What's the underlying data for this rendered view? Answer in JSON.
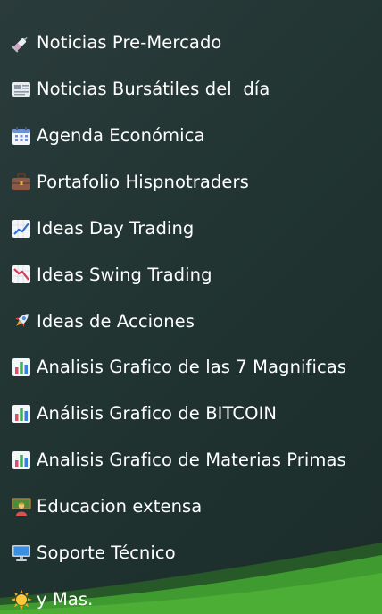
{
  "menu": {
    "items": [
      {
        "label": "Noticias Pre-Mercado",
        "icon": "syringe-icon"
      },
      {
        "label": "Noticias Bursátiles del  día",
        "icon": "newspaper-icon"
      },
      {
        "label": "Agenda Económica",
        "icon": "calendar-icon"
      },
      {
        "label": "Portafolio Hispnotraders",
        "icon": "briefcase-icon"
      },
      {
        "label": "Ideas Day Trading",
        "icon": "chart-increasing-icon"
      },
      {
        "label": "Ideas Swing Trading",
        "icon": "chart-decreasing-icon"
      },
      {
        "label": "Ideas de Acciones",
        "icon": "rocket-icon"
      },
      {
        "label": "Analisis Grafico de las 7 Magnificas",
        "icon": "bar-chart-icon"
      },
      {
        "label": "Análisis Grafico de BITCOIN",
        "icon": "bar-chart-icon"
      },
      {
        "label": "Analisis Grafico de Materias Primas",
        "icon": "bar-chart-icon"
      },
      {
        "label": "Educacion extensa",
        "icon": "teacher-icon"
      },
      {
        "label": "Soporte Técnico",
        "icon": "computer-icon"
      },
      {
        "label": "y Mas.",
        "icon": "sun-icon"
      }
    ]
  },
  "colors": {
    "background": "#233634",
    "text": "#ffffff",
    "wave_green": "#3f9a2f"
  }
}
